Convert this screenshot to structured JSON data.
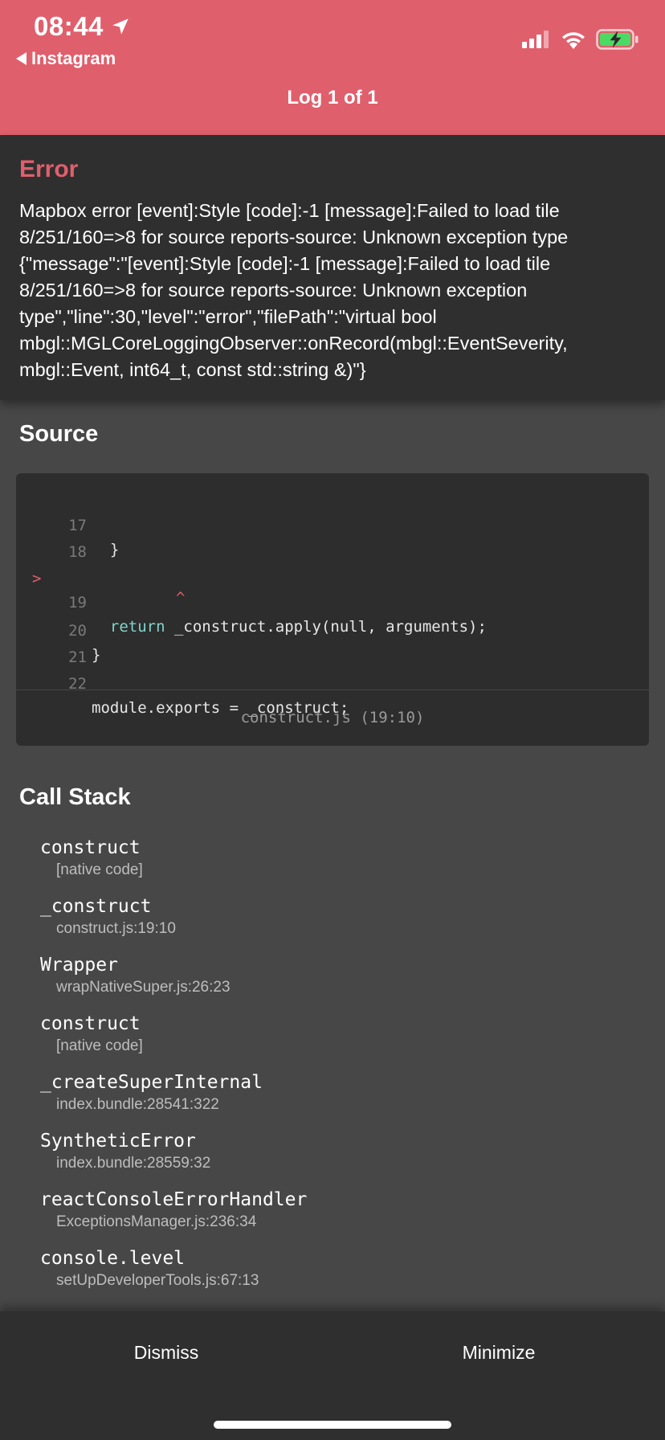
{
  "status_bar": {
    "time": "08:44",
    "back_app": "Instagram",
    "icons": [
      "location-arrow-icon",
      "cellular-signal-icon",
      "wifi-icon",
      "battery-charging-icon"
    ]
  },
  "header": {
    "title": "Log 1 of 1",
    "color": "#e05f6c"
  },
  "error": {
    "title": "Error",
    "message": "Mapbox error [event]:Style [code]:-1 [message]:Failed to load tile 8/251/160=>8 for source reports-source: Unknown exception type {\"message\":\"[event]:Style [code]:-1 [message]:Failed to load tile 8/251/160=>8 for source reports-source: Unknown exception type\",\"line\":30,\"level\":\"error\",\"filePath\":\"virtual bool mbgl::MGLCoreLoggingObserver::onRecord(mbgl::EventSeverity, mbgl::Event, int64_t, const std::string &)\"}"
  },
  "source": {
    "title": "Source",
    "lines": [
      {
        "num": "17",
        "text": "  }"
      },
      {
        "num": "18",
        "text": ""
      },
      {
        "num": "19",
        "marker": ">",
        "keyword": "return",
        "text": " _construct.apply(null, arguments);",
        "caret": "^"
      },
      {
        "num": "20",
        "text": "}"
      },
      {
        "num": "21",
        "text": ""
      },
      {
        "num": "22",
        "text": "module.exports = _construct;"
      }
    ],
    "file": "construct.js (19:10)"
  },
  "call_stack": {
    "title": "Call Stack",
    "frames": [
      {
        "fn": "construct",
        "loc": "[native code]"
      },
      {
        "fn": "_construct",
        "loc": "construct.js:19:10"
      },
      {
        "fn": "Wrapper",
        "loc": "wrapNativeSuper.js:26:23"
      },
      {
        "fn": "construct",
        "loc": "[native code]"
      },
      {
        "fn": "_createSuperInternal",
        "loc": "index.bundle:28541:322"
      },
      {
        "fn": "SyntheticError",
        "loc": "index.bundle:28559:32"
      },
      {
        "fn": "reactConsoleErrorHandler",
        "loc": "ExceptionsManager.js:236:34"
      },
      {
        "fn": "console.level",
        "loc": "setUpDeveloperTools.js:67:13"
      }
    ]
  },
  "bottom_bar": {
    "dismiss": "Dismiss",
    "minimize": "Minimize"
  }
}
